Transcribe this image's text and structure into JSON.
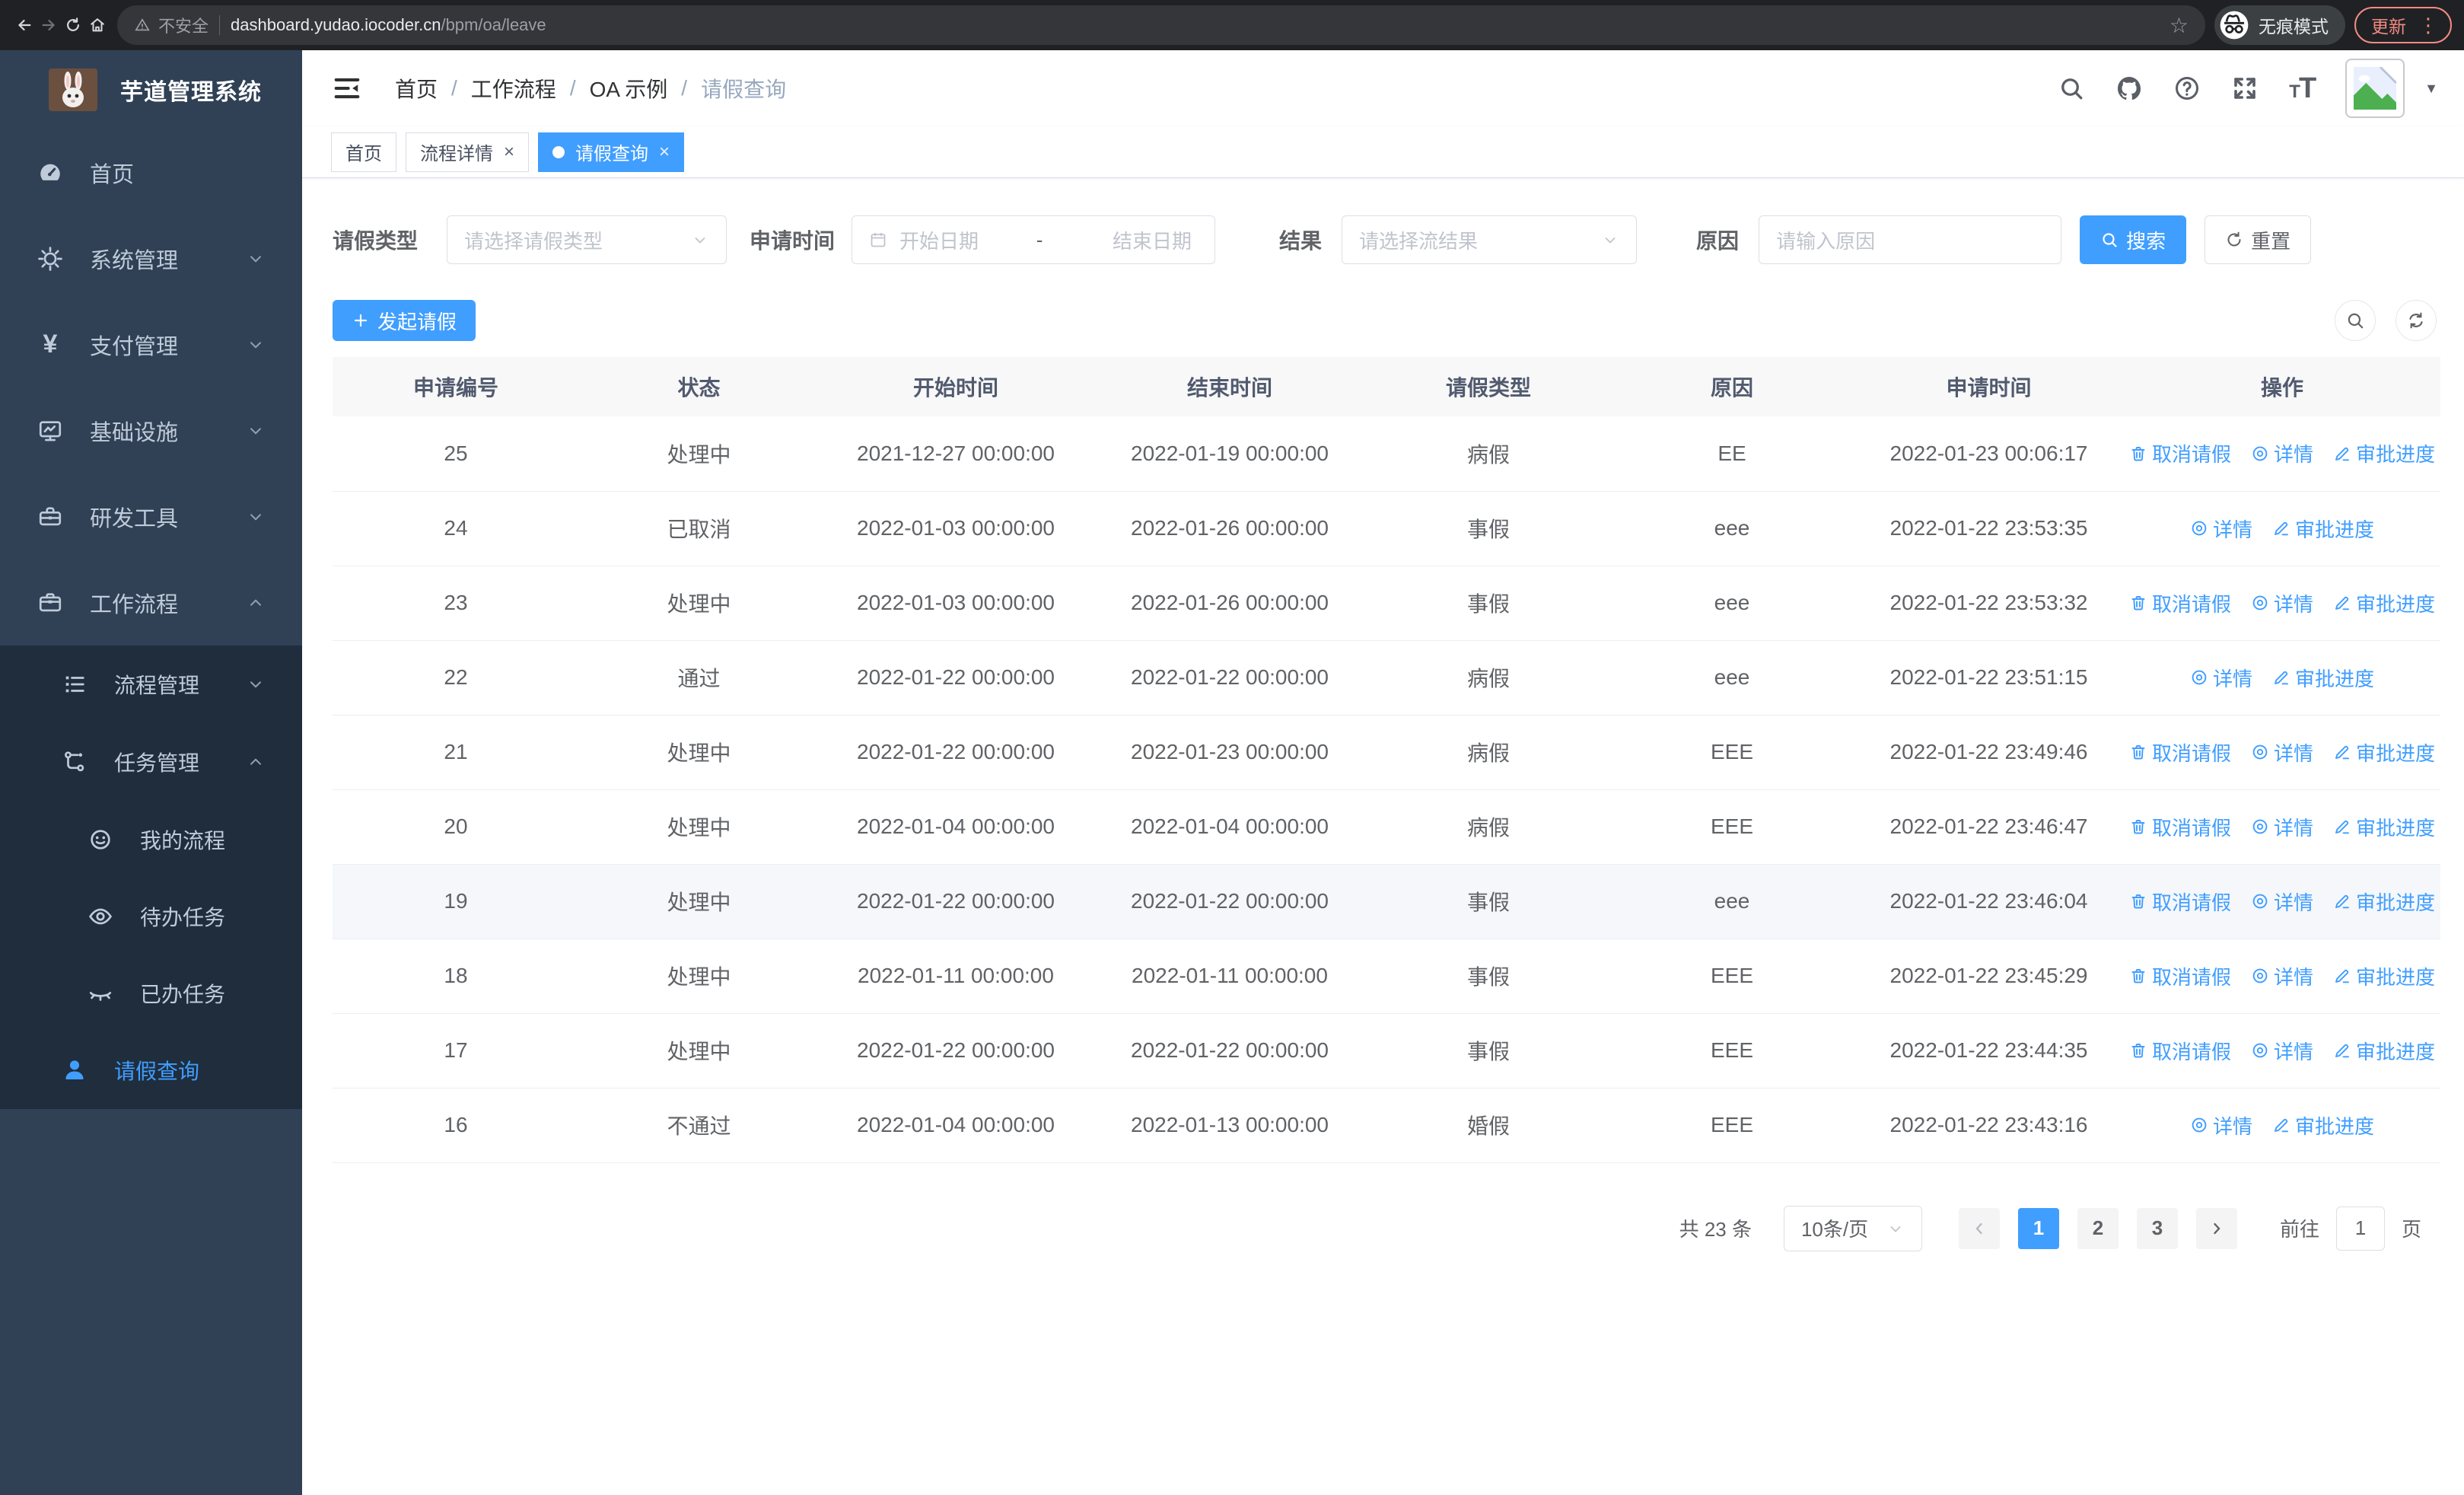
{
  "browser": {
    "security_label": "不安全",
    "url_host": "dashboard.yudao.iocoder.cn",
    "url_path": "/bpm/oa/leave",
    "incognito_label": "无痕模式",
    "update_label": "更新"
  },
  "sidebar": {
    "title": "芋道管理系统",
    "menu": [
      {
        "label": "首页",
        "icon": "dashboard-icon",
        "level": 0
      },
      {
        "label": "系统管理",
        "icon": "gear-icon",
        "level": 0,
        "chevron": "down"
      },
      {
        "label": "支付管理",
        "icon": "yen-icon",
        "level": 0,
        "chevron": "down"
      },
      {
        "label": "基础设施",
        "icon": "monitor-icon",
        "level": 0,
        "chevron": "down"
      },
      {
        "label": "研发工具",
        "icon": "toolbox-icon",
        "level": 0,
        "chevron": "down"
      },
      {
        "label": "工作流程",
        "icon": "briefcase-icon",
        "level": 0,
        "chevron": "up"
      }
    ],
    "submenu": [
      {
        "label": "流程管理",
        "icon": "flow-list-icon",
        "level": 1,
        "chevron": "down"
      },
      {
        "label": "任务管理",
        "icon": "task-tree-icon",
        "level": 1,
        "chevron": "up"
      },
      {
        "label": "我的流程",
        "icon": "smile-icon",
        "level": 2
      },
      {
        "label": "待办任务",
        "icon": "eye-open-icon",
        "level": 2
      },
      {
        "label": "已办任务",
        "icon": "eye-closed-icon",
        "level": 2
      },
      {
        "label": "请假查询",
        "icon": "user-icon",
        "level": 1,
        "active": true
      }
    ]
  },
  "header": {
    "breadcrumb": [
      "首页",
      "工作流程",
      "OA 示例",
      "请假查询"
    ],
    "tabs": [
      {
        "label": "首页",
        "closable": false,
        "active": false
      },
      {
        "label": "流程详情",
        "closable": true,
        "active": false
      },
      {
        "label": "请假查询",
        "closable": true,
        "active": true
      }
    ]
  },
  "filters": {
    "leave_type_label": "请假类型",
    "leave_type_placeholder": "请选择请假类型",
    "apply_time_label": "申请时间",
    "start_placeholder": "开始日期",
    "range_separator": "-",
    "end_placeholder": "结束日期",
    "result_label": "结果",
    "result_placeholder": "请选择流结果",
    "reason_label": "原因",
    "reason_placeholder": "请输入原因",
    "search_label": "搜索",
    "reset_label": "重置"
  },
  "toolbar": {
    "create_label": "发起请假"
  },
  "table": {
    "columns": [
      "申请编号",
      "状态",
      "开始时间",
      "结束时间",
      "请假类型",
      "原因",
      "申请时间",
      "操作"
    ],
    "action_labels": {
      "cancel": "取消请假",
      "detail": "详情",
      "progress": "审批进度"
    },
    "rows": [
      {
        "id": "25",
        "status": "处理中",
        "start": "2021-12-27 00:00:00",
        "end": "2022-01-19 00:00:00",
        "type": "病假",
        "reason": "EE",
        "applied": "2022-01-23 00:06:17",
        "actions": [
          "cancel",
          "detail",
          "progress"
        ],
        "highlight": false
      },
      {
        "id": "24",
        "status": "已取消",
        "start": "2022-01-03 00:00:00",
        "end": "2022-01-26 00:00:00",
        "type": "事假",
        "reason": "eee",
        "applied": "2022-01-22 23:53:35",
        "actions": [
          "detail",
          "progress"
        ],
        "highlight": false
      },
      {
        "id": "23",
        "status": "处理中",
        "start": "2022-01-03 00:00:00",
        "end": "2022-01-26 00:00:00",
        "type": "事假",
        "reason": "eee",
        "applied": "2022-01-22 23:53:32",
        "actions": [
          "cancel",
          "detail",
          "progress"
        ],
        "highlight": false
      },
      {
        "id": "22",
        "status": "通过",
        "start": "2022-01-22 00:00:00",
        "end": "2022-01-22 00:00:00",
        "type": "病假",
        "reason": "eee",
        "applied": "2022-01-22 23:51:15",
        "actions": [
          "detail",
          "progress"
        ],
        "highlight": false
      },
      {
        "id": "21",
        "status": "处理中",
        "start": "2022-01-22 00:00:00",
        "end": "2022-01-23 00:00:00",
        "type": "病假",
        "reason": "EEE",
        "applied": "2022-01-22 23:49:46",
        "actions": [
          "cancel",
          "detail",
          "progress"
        ],
        "highlight": false
      },
      {
        "id": "20",
        "status": "处理中",
        "start": "2022-01-04 00:00:00",
        "end": "2022-01-04 00:00:00",
        "type": "病假",
        "reason": "EEE",
        "applied": "2022-01-22 23:46:47",
        "actions": [
          "cancel",
          "detail",
          "progress"
        ],
        "highlight": false
      },
      {
        "id": "19",
        "status": "处理中",
        "start": "2022-01-22 00:00:00",
        "end": "2022-01-22 00:00:00",
        "type": "事假",
        "reason": "eee",
        "applied": "2022-01-22 23:46:04",
        "actions": [
          "cancel",
          "detail",
          "progress"
        ],
        "highlight": true
      },
      {
        "id": "18",
        "status": "处理中",
        "start": "2022-01-11 00:00:00",
        "end": "2022-01-11 00:00:00",
        "type": "事假",
        "reason": "EEE",
        "applied": "2022-01-22 23:45:29",
        "actions": [
          "cancel",
          "detail",
          "progress"
        ],
        "highlight": false
      },
      {
        "id": "17",
        "status": "处理中",
        "start": "2022-01-22 00:00:00",
        "end": "2022-01-22 00:00:00",
        "type": "事假",
        "reason": "EEE",
        "applied": "2022-01-22 23:44:35",
        "actions": [
          "cancel",
          "detail",
          "progress"
        ],
        "highlight": false
      },
      {
        "id": "16",
        "status": "不通过",
        "start": "2022-01-04 00:00:00",
        "end": "2022-01-13 00:00:00",
        "type": "婚假",
        "reason": "EEE",
        "applied": "2022-01-22 23:43:16",
        "actions": [
          "detail",
          "progress"
        ],
        "highlight": false
      }
    ]
  },
  "pagination": {
    "total_label": "共 23 条",
    "page_size": "10条/页",
    "pages": [
      "1",
      "2",
      "3"
    ],
    "active_page": "1",
    "goto_label": "前往",
    "goto_value": "1",
    "goto_suffix": "页"
  },
  "colors": {
    "accent": "#409eff",
    "sidebar_bg": "#304156",
    "submenu_bg": "#1f2d3d",
    "chrome_bg": "#202124",
    "update_accent": "#f28b82"
  }
}
